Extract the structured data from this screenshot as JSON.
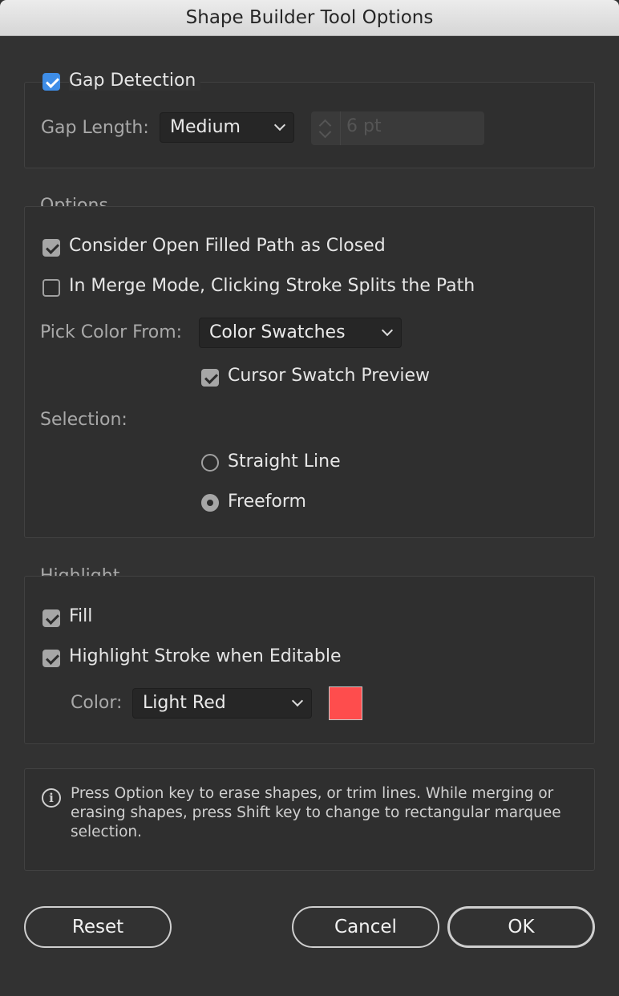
{
  "window": {
    "title": "Shape Builder Tool Options"
  },
  "gap": {
    "checkbox_label": "Gap Detection",
    "gap_length_label": "Gap Length:",
    "gap_length_value": "Medium",
    "stepper_value": "6 pt"
  },
  "options": {
    "section_title": "Options",
    "consider_open_label": "Consider Open Filled Path as Closed",
    "merge_mode_label": "In Merge Mode, Clicking Stroke Splits the Path",
    "pick_color_label": "Pick Color From:",
    "pick_color_value": "Color Swatches",
    "cursor_preview_label": "Cursor Swatch Preview",
    "selection_label": "Selection:",
    "straight_line_label": "Straight Line",
    "freeform_label": "Freeform"
  },
  "highlight": {
    "section_title": "Highlight",
    "fill_label": "Fill",
    "stroke_label": "Highlight Stroke when Editable",
    "color_label": "Color:",
    "color_value": "Light Red",
    "swatch_color": "#fe4d4d"
  },
  "info": {
    "icon": "info-icon",
    "text": "Press Option key to erase shapes, or trim lines. While merging or erasing shapes, press Shift key to change to rectangular marquee selection."
  },
  "buttons": {
    "reset": "Reset",
    "cancel": "Cancel",
    "ok": "OK"
  }
}
